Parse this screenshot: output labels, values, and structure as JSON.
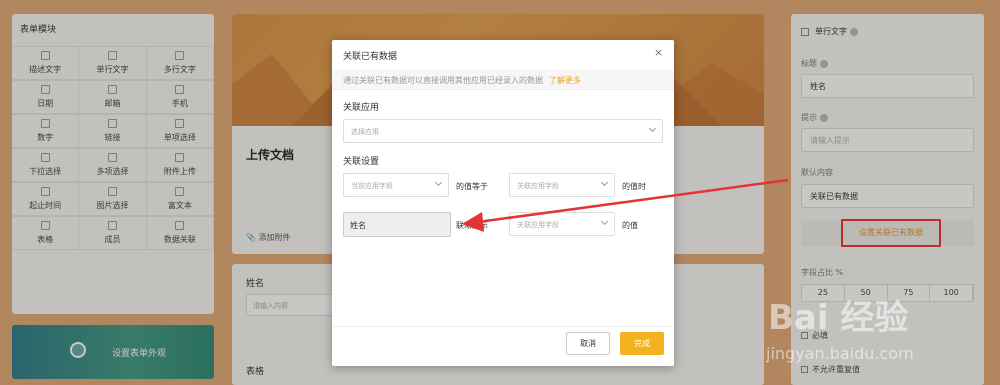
{
  "left_panel": {
    "title": "表单模块",
    "widgets": [
      "描述文字",
      "单行文字",
      "多行文字",
      "日期",
      "邮箱",
      "手机",
      "数字",
      "链接",
      "单项选择",
      "下拉选择",
      "多项选择",
      "附件上传",
      "起止时间",
      "图片选择",
      "富文本",
      "表格",
      "成员",
      "数据关联"
    ],
    "appearance_button": "设置表单外观"
  },
  "form": {
    "title": "上传文档",
    "add_attachment": "添加附件",
    "field_label": "姓名",
    "field_placeholder": "请输入内容",
    "table_label": "表格"
  },
  "right_panel": {
    "header": "单行文字",
    "title_label": "标题",
    "title_value": "姓名",
    "hint_label": "提示",
    "hint_placeholder": "请输入提示",
    "default_label": "默认内容",
    "default_value": "关联已有数据",
    "set_linked_button": "设置关联已有数据",
    "width_label": "字段占比 %",
    "width_options": [
      "25",
      "50",
      "75",
      "100"
    ],
    "checkbox_required": "必填",
    "checkbox_no_repeat": "不允许重复值"
  },
  "modal": {
    "title": "关联已有数据",
    "hint": "通过关联已有数据可以直接调用其他应用已经录入的数据",
    "learn_more": "了解更多",
    "app_label": "关联应用",
    "app_placeholder": "选择应用",
    "settings_label": "关联设置",
    "current_field_placeholder": "当前应用字段",
    "equals_text": "的值等于",
    "linked_field_placeholder": "关联应用字段",
    "when_text": "的值时",
    "name_value": "姓名",
    "display_text": "联动显示",
    "value_text": "的值",
    "cancel": "取消",
    "done": "完成"
  },
  "watermark": {
    "brand": "Bai 经验",
    "url": "jingyan.baidu.com"
  },
  "colors": {
    "accent": "#f5b21f",
    "link": "#f0a020",
    "annotation": "#e33333"
  }
}
